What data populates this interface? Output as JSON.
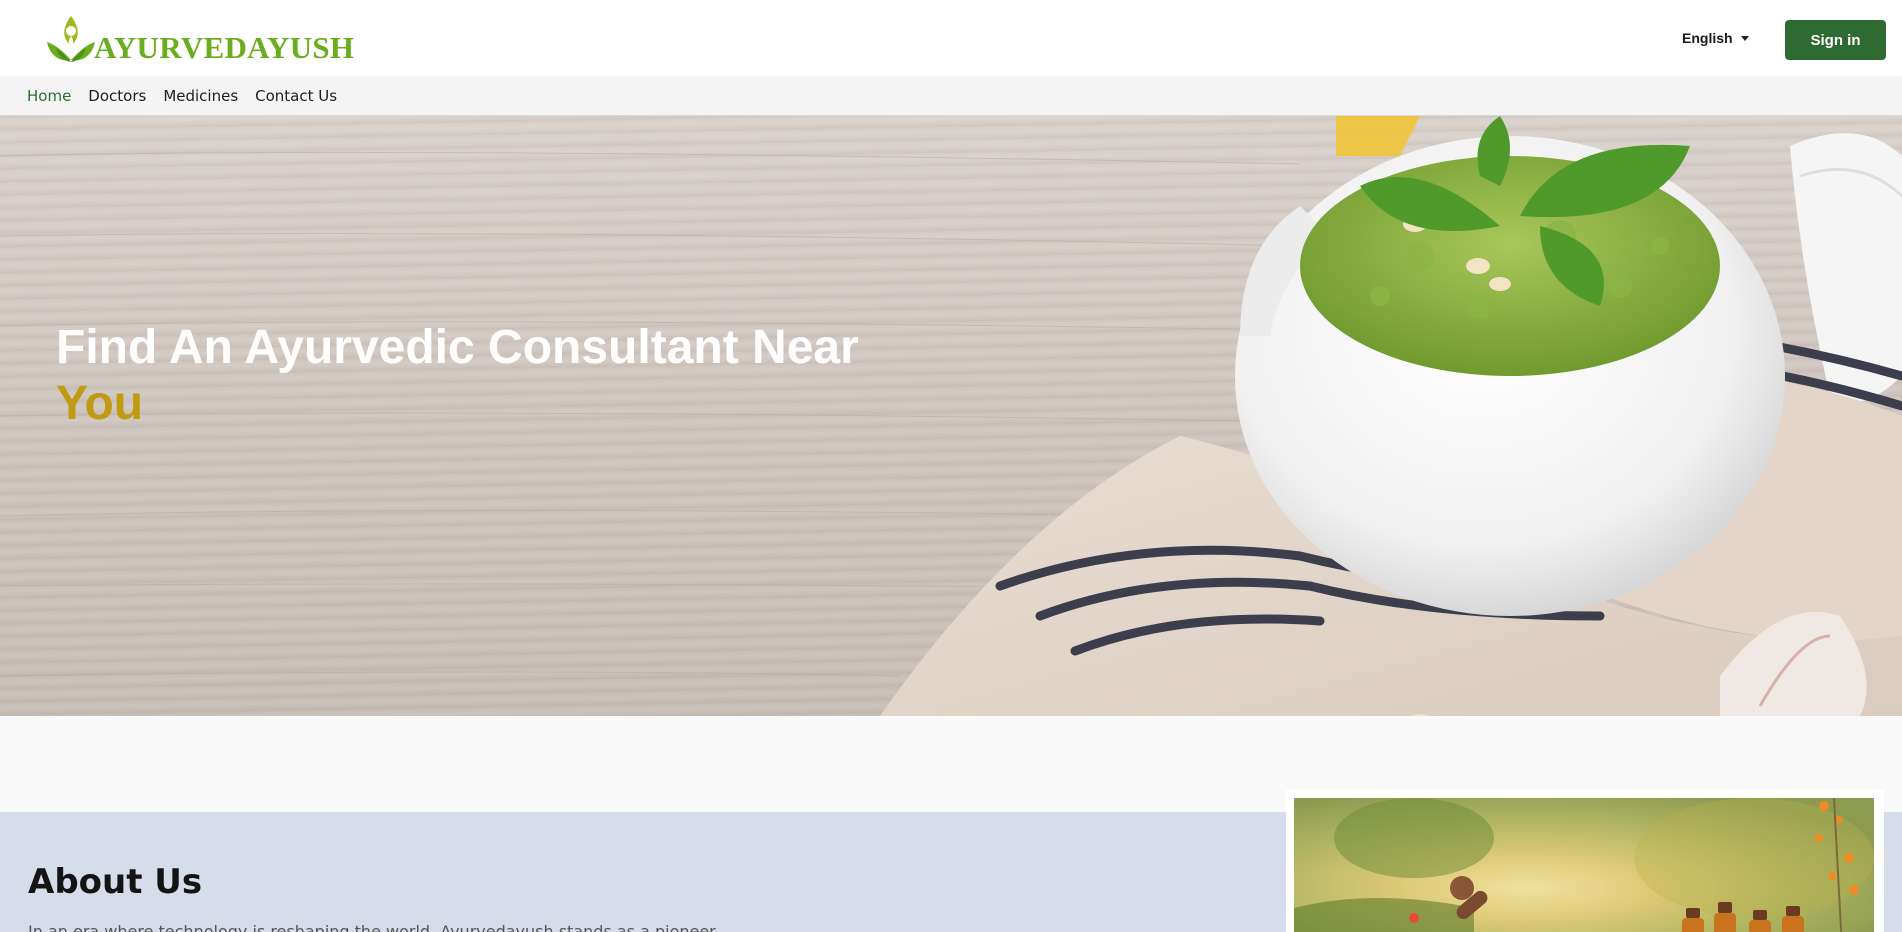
{
  "brand": {
    "name": "AYURVEDAYUSH",
    "primary_color": "#2f6a32",
    "logo_color": "#6aae1f",
    "accent_color": "#c09a10"
  },
  "header": {
    "language": "English",
    "signin_label": "Sign in"
  },
  "nav": {
    "items": [
      {
        "label": "Home",
        "active": true
      },
      {
        "label": "Doctors",
        "active": false
      },
      {
        "label": "Medicines",
        "active": false
      },
      {
        "label": "Contact Us",
        "active": false
      }
    ]
  },
  "hero": {
    "title_line1": "Find An Ayurvedic Consultant Near",
    "title_line2": "You"
  },
  "about": {
    "title": "About Us",
    "text": "In an era where technology is reshaping the world, Ayurvedayush stands as a pioneer,"
  }
}
